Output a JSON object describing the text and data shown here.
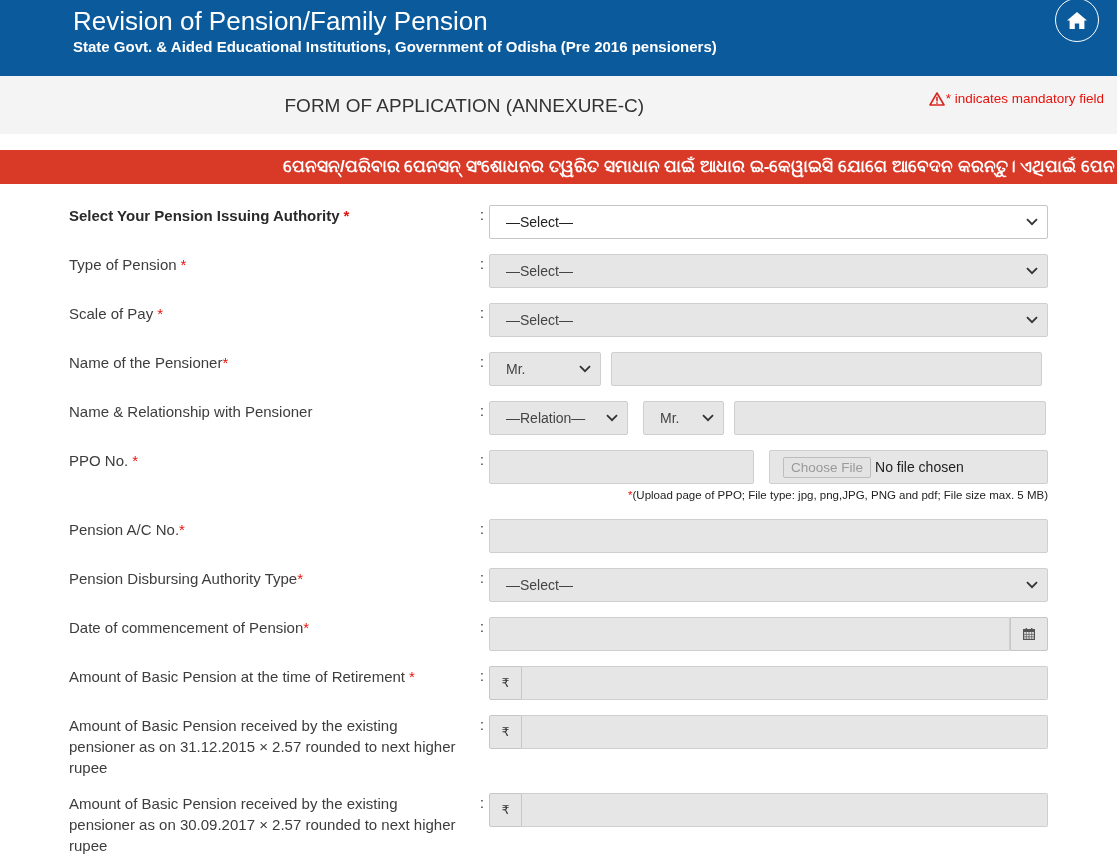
{
  "header": {
    "title": "Revision of Pension/Family Pension",
    "subtitle": "State Govt. & Aided Educational Institutions, Government of Odisha (Pre 2016 pensioners)"
  },
  "form_heading": "FORM OF APPLICATION (ANNEXURE-C)",
  "mandatory_note": "* indicates mandatory field",
  "banner": "ପେନସନ୍/ପରିବାର ପେନସନ୍ ସଂଶୋଧନର ତ୍ୱରିତ ସମାଧାନ ପାଇଁ ଆଧାର ଇ-କେୱାଇସି ଯୋଗେ ଆବେଦନ କରନ୍ତୁ। ଏଥିପାଇଁ ପେନ",
  "fields": [
    {
      "kind": "select",
      "label": "Select Your Pension Issuing Authority",
      "bold": true,
      "asterisk": "*",
      "asterisk_gap": true,
      "colon": ":",
      "value": "—Select—",
      "disabled": false
    },
    {
      "kind": "select",
      "label": "Type of Pension",
      "bold": false,
      "asterisk": "*",
      "asterisk_gap": true,
      "colon": ":",
      "value": "—Select—",
      "disabled": true
    },
    {
      "kind": "select",
      "label": "Scale of Pay",
      "bold": false,
      "asterisk": "*",
      "asterisk_gap": true,
      "colon": ":",
      "value": "—Select—",
      "disabled": true
    },
    {
      "kind": "title_name",
      "label": "Name of the Pensioner",
      "bold": false,
      "asterisk": "*",
      "asterisk_gap": false,
      "colon": ":",
      "title": "Mr.",
      "disabled": true
    },
    {
      "kind": "relation",
      "label": "Name & Relationship with Pensioner",
      "bold": false,
      "colon": ":",
      "relation": "—Relation—",
      "title": "Mr.",
      "disabled": true
    },
    {
      "kind": "file",
      "label": "PPO No.",
      "bold": false,
      "asterisk": "*",
      "asterisk_gap": true,
      "colon": ":",
      "file_button": "Choose File",
      "file_status": "No file chosen",
      "note_mark": "*",
      "note": "(Upload page of PPO; File type: jpg, png,JPG, PNG and pdf; File size max. 5 MB)",
      "disabled": true
    },
    {
      "kind": "input",
      "label": "Pension A/C No.",
      "bold": false,
      "asterisk": "*",
      "asterisk_gap": false,
      "colon": ":",
      "disabled": true
    },
    {
      "kind": "select",
      "label": "Pension Disbursing Authority Type",
      "bold": false,
      "asterisk": "*",
      "asterisk_gap": false,
      "colon": ":",
      "value": "—Select—",
      "disabled": true
    },
    {
      "kind": "date",
      "label": "Date of commencement of Pension",
      "bold": false,
      "asterisk": "*",
      "asterisk_gap": false,
      "colon": ":",
      "disabled": true
    },
    {
      "kind": "currency",
      "label": "Amount of Basic Pension at the time of Retirement",
      "bold": false,
      "asterisk": "*",
      "asterisk_gap": true,
      "colon": ":",
      "prefix": "₹",
      "disabled": true
    },
    {
      "kind": "currency",
      "label": "Amount of Basic Pension received by the existing pensioner as on 31.12.2015 × 2.57 rounded to next higher rupee",
      "bold": false,
      "colon": ":",
      "prefix": "₹",
      "disabled": true
    },
    {
      "kind": "currency",
      "label": "Amount of Basic Pension received by the existing pensioner as on 30.09.2017 × 2.57 rounded to next higher rupee",
      "bold": false,
      "colon": ":",
      "prefix": "₹",
      "disabled": true
    }
  ]
}
